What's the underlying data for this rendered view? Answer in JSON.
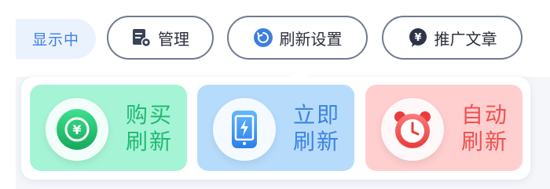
{
  "toolbar": {
    "status": "显示中",
    "manage": "管理",
    "refresh_settings": "刷新设置",
    "promote_article": "推广文章"
  },
  "actions": [
    {
      "line1": "购买",
      "line2": "刷新",
      "icon": "yuan-coin-icon",
      "color": "#21ba73"
    },
    {
      "line1": "立即",
      "line2": "刷新",
      "icon": "phone-lightning-icon",
      "color": "#3d84df"
    },
    {
      "line1": "自动",
      "line2": "刷新",
      "icon": "alarm-clock-icon",
      "color": "#f05050"
    }
  ],
  "colors": {
    "accent_blue": "#3d7fe0",
    "buy_bg": "#a6f4d6",
    "now_bg": "#b7dcfb",
    "auto_bg": "#ffcfcf"
  }
}
